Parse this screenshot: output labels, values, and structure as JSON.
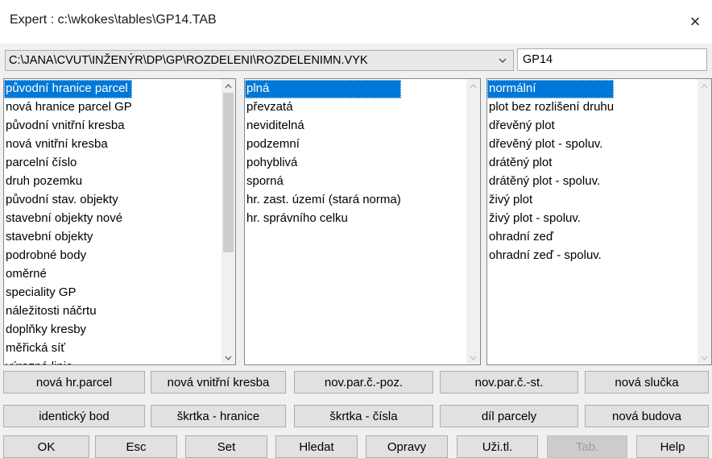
{
  "window": {
    "title": "Expert : c:\\wkokes\\tables\\GP14.TAB",
    "close_glyph": "×"
  },
  "path_combo": {
    "value": "C:\\JANA\\CVUT\\INŽENÝR\\DP\\GP\\ROZDELENI\\ROZDELENIMN.VYK"
  },
  "table_field": {
    "value": "GP14"
  },
  "lists": {
    "left": {
      "selected_index": 0,
      "items": [
        "původní hranice parcel",
        "nová hranice parcel GP",
        "původní vnitřní kresba",
        "nová vnitřní kresba",
        "parcelní číslo",
        "druh pozemku",
        "původní stav. objekty",
        "stavební objekty nové",
        "stavební objekty",
        "podrobné body",
        "oměrné",
        "speciality GP",
        "náležitosti náčrtu",
        "doplňky kresby",
        "měřická síť",
        "výrazné linie"
      ]
    },
    "middle": {
      "selected_index": 0,
      "items": [
        "plná",
        "převzatá",
        "neviditelná",
        "podzemní",
        "pohyblivá",
        "sporná",
        "hr. zast. území (stará norma)",
        "hr. správního celku"
      ]
    },
    "right": {
      "selected_index": 0,
      "items": [
        "normální",
        "plot bez rozlišení druhu",
        "dřevěný plot",
        "dřevěný plot - spoluv.",
        "drátěný plot",
        "drátěný plot - spoluv.",
        "živý plot",
        "živý plot - spoluv.",
        "ohradní zeď",
        "ohradní zeď - spoluv."
      ]
    }
  },
  "buttons": {
    "row1": [
      "nová hr.parcel",
      "nová vnitřní kresba",
      "nov.par.č.-poz.",
      "nov.par.č.-st.",
      "nová slučka"
    ],
    "row2": [
      "identický bod",
      "škrtka - hranice",
      "škrtka - čísla",
      "díl parcely",
      "nová budova"
    ],
    "row3": [
      "OK",
      "Esc",
      "Set",
      "Hledat",
      "Opravy",
      "Uži.tl.",
      "Tab.",
      "Help"
    ]
  },
  "colors": {
    "selection": "#0078d7",
    "disabled_text": "#9e9e9e"
  }
}
